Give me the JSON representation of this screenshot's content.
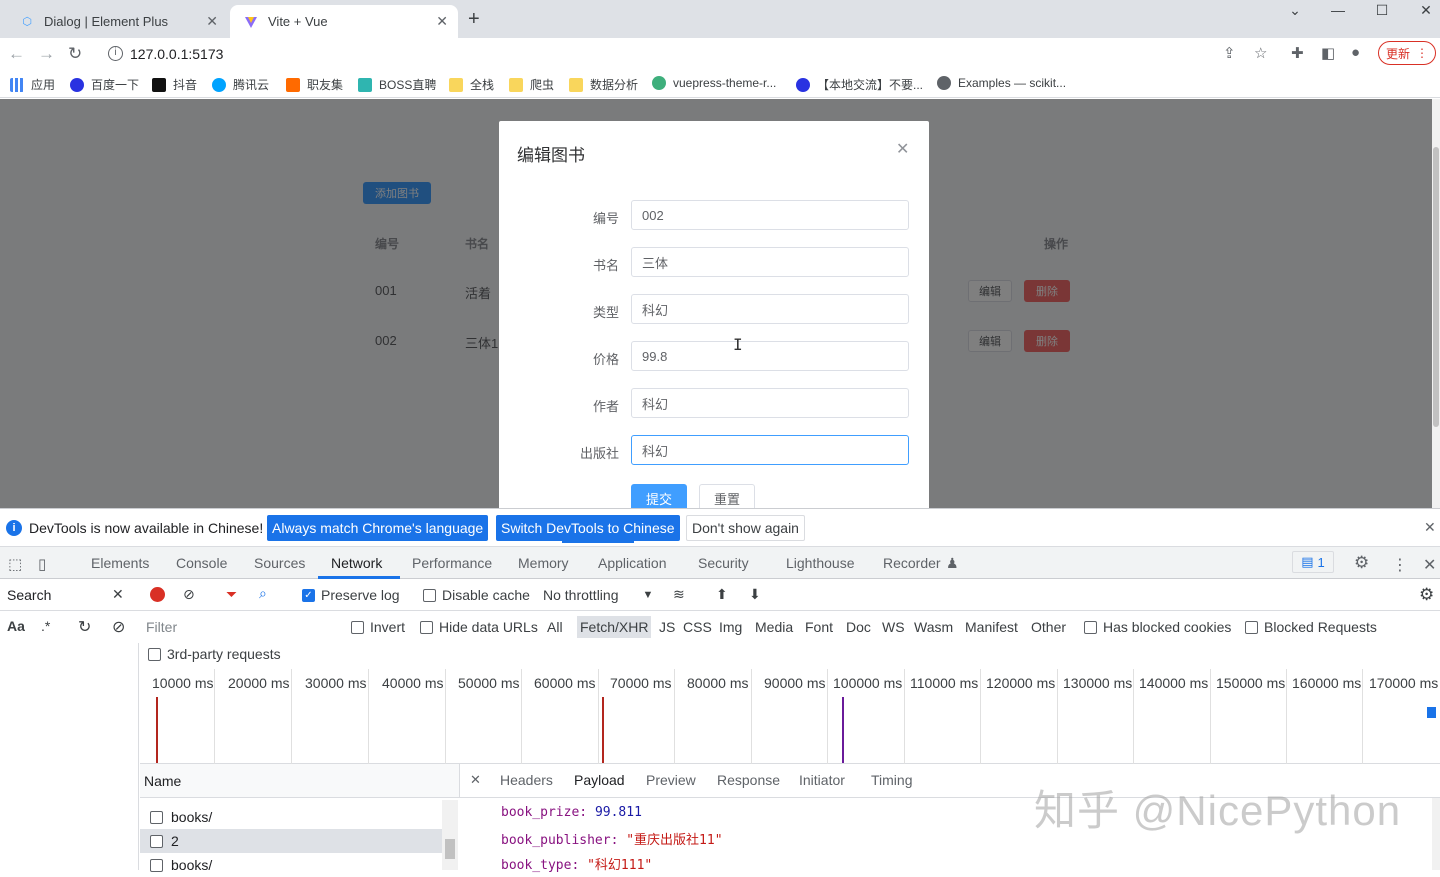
{
  "browser": {
    "tabs": [
      {
        "title": "Dialog | Element Plus"
      },
      {
        "title": "Vite + Vue"
      }
    ],
    "url": "127.0.0.1:5173",
    "update_label": "更新",
    "bookmarks": [
      "应用",
      "百度一下",
      "抖音",
      "腾讯云",
      "职友集",
      "BOSS直聘",
      "全栈",
      "爬虫",
      "数据分析",
      "vuepress-theme-r...",
      "【本地交流】不要...",
      "Examples — scikit..."
    ]
  },
  "page": {
    "add_button": "添加图书",
    "table_headers": {
      "id": "编号",
      "name": "书名",
      "actions": "操作"
    },
    "rows": [
      {
        "id": "001",
        "name": "活着",
        "edit": "编辑",
        "delete": "删除"
      },
      {
        "id": "002",
        "name": "三体1",
        "edit": "编辑",
        "delete": "删除"
      }
    ]
  },
  "dialog": {
    "title": "编辑图书",
    "fields": [
      {
        "label": "编号",
        "value": "002"
      },
      {
        "label": "书名",
        "value": "三体"
      },
      {
        "label": "类型",
        "value": "科幻"
      },
      {
        "label": "价格",
        "value": "99.8"
      },
      {
        "label": "作者",
        "value": "科幻"
      },
      {
        "label": "出版社",
        "value": "科幻"
      }
    ],
    "submit": "提交",
    "reset": "重置"
  },
  "devtools": {
    "infobar": {
      "text": "DevTools is now available in Chinese!",
      "btn_match": "Always match Chrome's language",
      "btn_switch": "Switch DevTools to Chinese",
      "btn_dont": "Don't show again"
    },
    "tabs": [
      "Elements",
      "Console",
      "Sources",
      "Network",
      "Performance",
      "Memory",
      "Application",
      "Security",
      "Lighthouse",
      "Recorder"
    ],
    "active_tab": "Network",
    "message_count": "1",
    "search_label": "Search",
    "preserve_log": "Preserve log",
    "disable_cache": "Disable cache",
    "throttling": "No throttling",
    "filter_placeholder": "Filter",
    "invert": "Invert",
    "hide_data_urls": "Hide data URLs",
    "types": [
      "All",
      "Fetch/XHR",
      "JS",
      "CSS",
      "Img",
      "Media",
      "Font",
      "Doc",
      "WS",
      "Wasm",
      "Manifest",
      "Other"
    ],
    "selected_type": "Fetch/XHR",
    "has_blocked_cookies": "Has blocked cookies",
    "blocked_requests": "Blocked Requests",
    "third_party": "3rd-party requests",
    "timeline_ticks": [
      "10000 ms",
      "20000 ms",
      "30000 ms",
      "40000 ms",
      "50000 ms",
      "60000 ms",
      "70000 ms",
      "80000 ms",
      "90000 ms",
      "100000 ms",
      "110000 ms",
      "120000 ms",
      "130000 ms",
      "140000 ms",
      "150000 ms",
      "160000 ms",
      "170000 ms"
    ],
    "name_header": "Name",
    "requests": [
      "books/",
      "2",
      "books/"
    ],
    "detail_tabs": [
      "Headers",
      "Payload",
      "Preview",
      "Response",
      "Initiator",
      "Timing"
    ],
    "active_detail_tab": "Payload",
    "payload": [
      {
        "key": "book_prize",
        "value": "99.811"
      },
      {
        "key": "book_publisher",
        "value": "\"重庆出版社11\""
      },
      {
        "key": "book_type",
        "value": "\"科幻111\""
      }
    ]
  },
  "watermark": "知乎 @NicePython",
  "colors": {
    "primary": "#409eff",
    "danger": "#f56c6c",
    "devtools_blue": "#1a73e8"
  }
}
